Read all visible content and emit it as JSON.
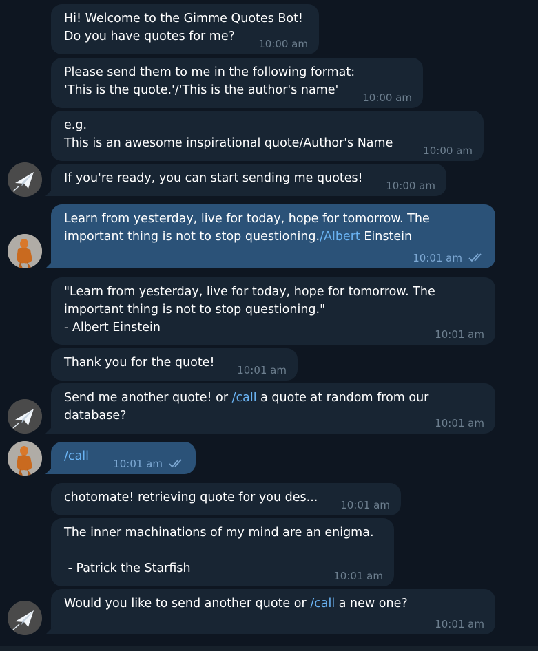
{
  "messages": [
    {
      "text": "Hi! Welcome to the Gimme Quotes Bot!\nDo you have quotes for me?",
      "time": "10:00 am"
    },
    {
      "text": "Please send them to me in the following format:\n'This is the quote.'/'This is the author's name'",
      "time": "10:00 am"
    },
    {
      "text": "e.g.\nThis is an awesome inspirational quote/Author's Name",
      "time": "10:00 am"
    },
    {
      "text": "If you're ready, you can start sending me quotes!",
      "time": "10:00 am"
    },
    {
      "text_part1": "Learn from yesterday, live for today, hope for tomorrow. The\nimportant thing is not to stop questioning.",
      "link": "/Albert",
      "text_part2": " Einstein",
      "time": "10:01 am",
      "status": "read"
    },
    {
      "text": "\"Learn from yesterday, live for today, hope for tomorrow. The\nimportant thing is not to stop questioning.\"\n- Albert Einstein",
      "time": "10:01 am"
    },
    {
      "text": "Thank you for the quote!",
      "time": "10:01 am"
    },
    {
      "text_part1": "Send me another quote! or ",
      "link": "/call",
      "text_part2": " a quote at random from our\ndatabase?",
      "time": "10:01 am"
    },
    {
      "link": "/call",
      "time": "10:01 am",
      "status": "read"
    },
    {
      "text": "chotomate! retrieving quote for you des...",
      "time": "10:01 am"
    },
    {
      "text": "The inner machinations of my mind are an enigma.\n\n - Patrick the Starfish",
      "time": "10:01 am"
    },
    {
      "text_part1": "Would you like to send another quote or ",
      "link": "/call",
      "text_part2": " a new one?",
      "time": "10:01 am"
    }
  ],
  "colors": {
    "background": "#0e1621",
    "incoming_bubble": "#182533",
    "outgoing_bubble": "#2b5278",
    "link": "#6ab3f3",
    "time_incoming": "#6d7f8f",
    "time_outgoing": "#7da8d3"
  },
  "icons": {
    "bot_avatar": "paper-plane-icon",
    "user_avatar": "figure-avatar",
    "read_status": "double-check-icon"
  }
}
